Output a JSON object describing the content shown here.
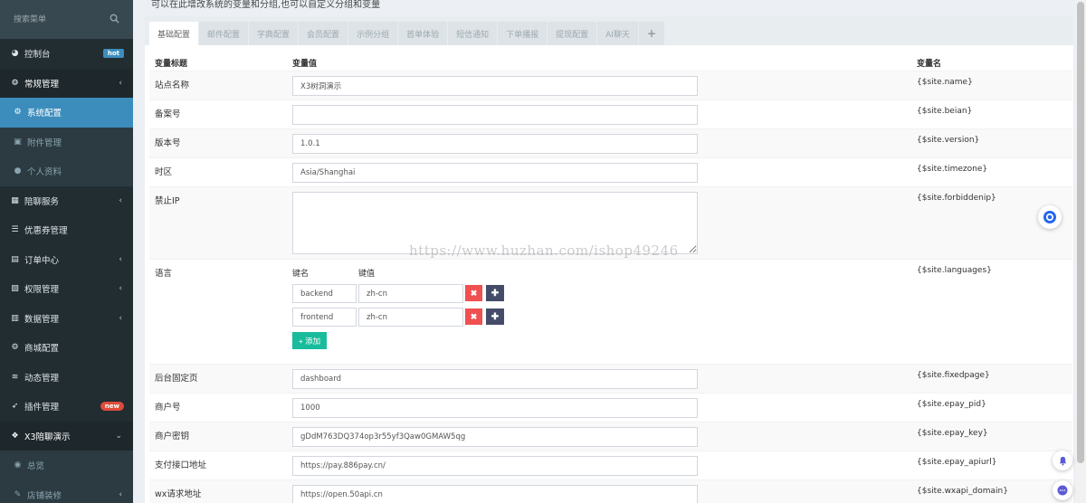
{
  "sidebar": {
    "search_placeholder": "搜索菜单",
    "items": [
      {
        "label": "控制台",
        "badge": "hot"
      },
      {
        "label": "常规管理"
      },
      {
        "label": "系统配置"
      },
      {
        "label": "附件管理"
      },
      {
        "label": "个人资料"
      },
      {
        "label": "陪聊服务"
      },
      {
        "label": "优惠券管理"
      },
      {
        "label": "订单中心"
      },
      {
        "label": "权限管理"
      },
      {
        "label": "数据管理"
      },
      {
        "label": "商城配置"
      },
      {
        "label": "动态管理"
      },
      {
        "label": "插件管理",
        "badge": "new"
      },
      {
        "label": "X3陪聊演示"
      },
      {
        "label": "总览"
      },
      {
        "label": "店铺装修"
      }
    ]
  },
  "header": {
    "subtitle": "可以在此增改系统的变量和分组,也可以自定义分组和变量"
  },
  "tabs": [
    "基础配置",
    "邮件配置",
    "字典配置",
    "会员配置",
    "示例分组",
    "首单体验",
    "短信通知",
    "下单播报",
    "提现配置",
    "AI聊天",
    "+"
  ],
  "table": {
    "headers": {
      "title": "变量标题",
      "value": "变量值",
      "name": "变量名"
    },
    "rows": [
      {
        "label": "站点名称",
        "value": "X3树洞演示",
        "var": "{$site.name}"
      },
      {
        "label": "备案号",
        "value": "",
        "var": "{$site.beian}"
      },
      {
        "label": "版本号",
        "value": "1.0.1",
        "var": "{$site.version}"
      },
      {
        "label": "时区",
        "value": "Asia/Shanghai",
        "var": "{$site.timezone}"
      },
      {
        "label": "禁止IP",
        "value": "",
        "var": "{$site.forbiddenip}"
      },
      {
        "label": "语言",
        "var": "{$site.languages}"
      },
      {
        "label": "后台固定页",
        "value": "dashboard",
        "var": "{$site.fixedpage}"
      },
      {
        "label": "商户号",
        "value": "1000",
        "var": "{$site.epay_pid}"
      },
      {
        "label": "商户密钥",
        "value": "gDdM763DQ374op3r55yf3Qaw0GMAW5qg",
        "var": "{$site.epay_key}"
      },
      {
        "label": "支付接口地址",
        "value": "https://pay.886pay.cn/",
        "var": "{$site.epay_apiurl}"
      },
      {
        "label": "wx请求地址",
        "value": "https://open.50api.cn",
        "var": "{$site.wxapi_domain}"
      }
    ],
    "languages": {
      "key_header": "键名",
      "value_header": "键值",
      "entries": [
        {
          "key": "backend",
          "value": "zh-cn"
        },
        {
          "key": "frontend",
          "value": "zh-cn"
        }
      ],
      "add_label": "+ 添加"
    }
  },
  "watermark": "https://www.huzhan.com/ishop49246"
}
